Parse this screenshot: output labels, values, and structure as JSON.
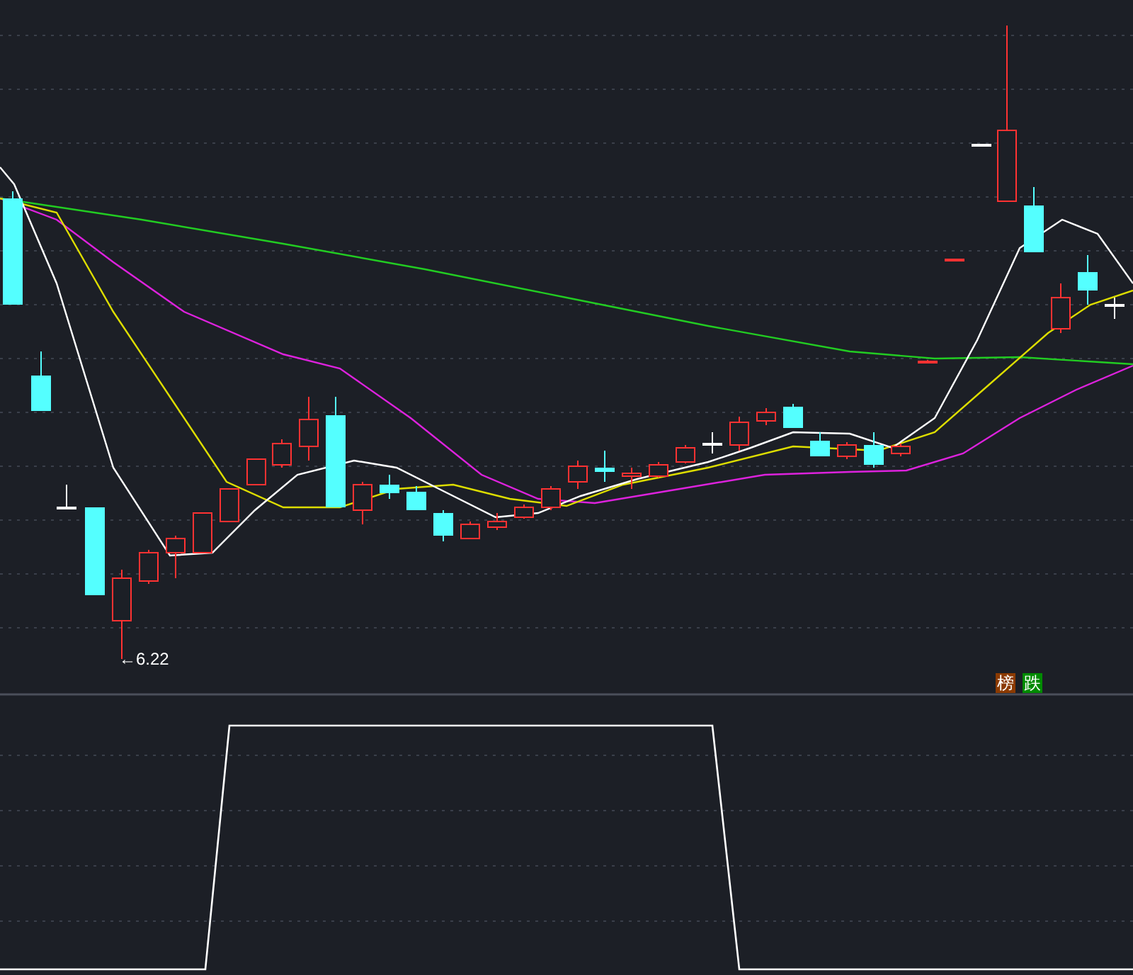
{
  "price_chart": {
    "low_marker": {
      "arrow": "←",
      "value": "6.22"
    },
    "badges": [
      {
        "label": "榜",
        "color": "#8b3a00"
      },
      {
        "label": "跌",
        "color": "#008a00"
      }
    ]
  }
}
